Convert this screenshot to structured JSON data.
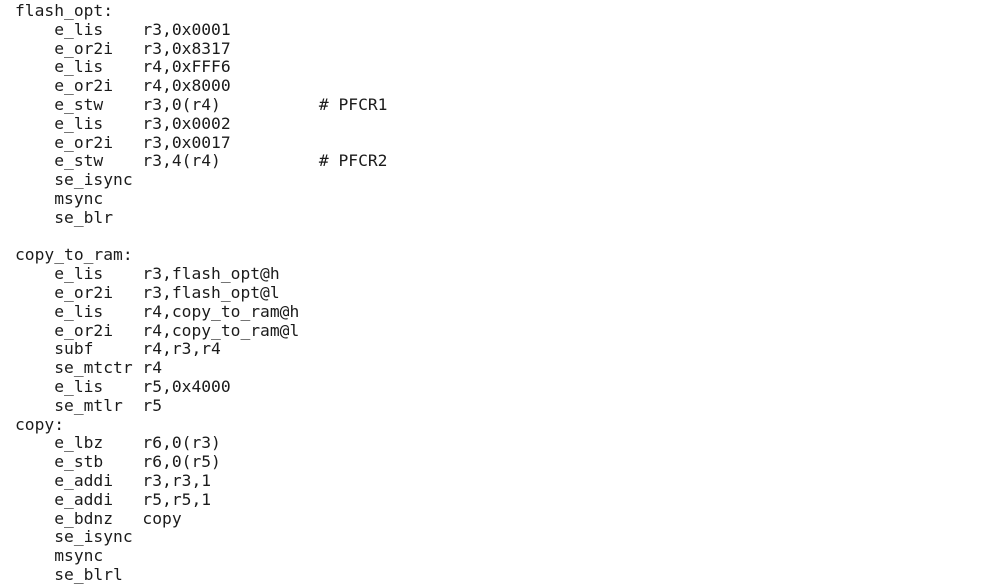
{
  "document": {
    "type": "assembly-source-listing",
    "language": "PowerPC VLE assembly",
    "background_color": "#ffffff",
    "text_color": "#1b1b1b",
    "columns": {
      "label": 0,
      "mnemonic": 4,
      "operand": 13,
      "comment": 30
    }
  },
  "code": {
    "lines": [
      "flash_opt:",
      "    e_lis    r3,0x0001",
      "    e_or2i   r3,0x8317",
      "    e_lis    r4,0xFFF6",
      "    e_or2i   r4,0x8000",
      "    e_stw    r3,0(r4)          # PFCR1",
      "    e_lis    r3,0x0002",
      "    e_or2i   r3,0x0017",
      "    e_stw    r3,4(r4)          # PFCR2",
      "    se_isync",
      "    msync",
      "    se_blr",
      "",
      "copy_to_ram:",
      "    e_lis    r3,flash_opt@h",
      "    e_or2i   r3,flash_opt@l",
      "    e_lis    r4,copy_to_ram@h",
      "    e_or2i   r4,copy_to_ram@l",
      "    subf     r4,r3,r4",
      "    se_mtctr r4",
      "    e_lis    r5,0x4000",
      "    se_mtlr  r5",
      "copy:",
      "    e_lbz    r6,0(r3)",
      "    e_stb    r6,0(r5)",
      "    e_addi   r3,r3,1",
      "    e_addi   r5,r5,1",
      "    e_bdnz   copy",
      "    se_isync",
      "    msync",
      "    se_blrl"
    ],
    "labels": [
      "flash_opt:",
      "copy_to_ram:",
      "copy:"
    ],
    "comments": [
      "# PFCR1",
      "# PFCR2"
    ],
    "mnemonics": [
      "e_lis",
      "e_or2i",
      "e_stw",
      "se_isync",
      "msync",
      "se_blr",
      "subf",
      "se_mtctr",
      "se_mtlr",
      "e_lbz",
      "e_stb",
      "e_addi",
      "e_bdnz",
      "se_blrl"
    ]
  }
}
